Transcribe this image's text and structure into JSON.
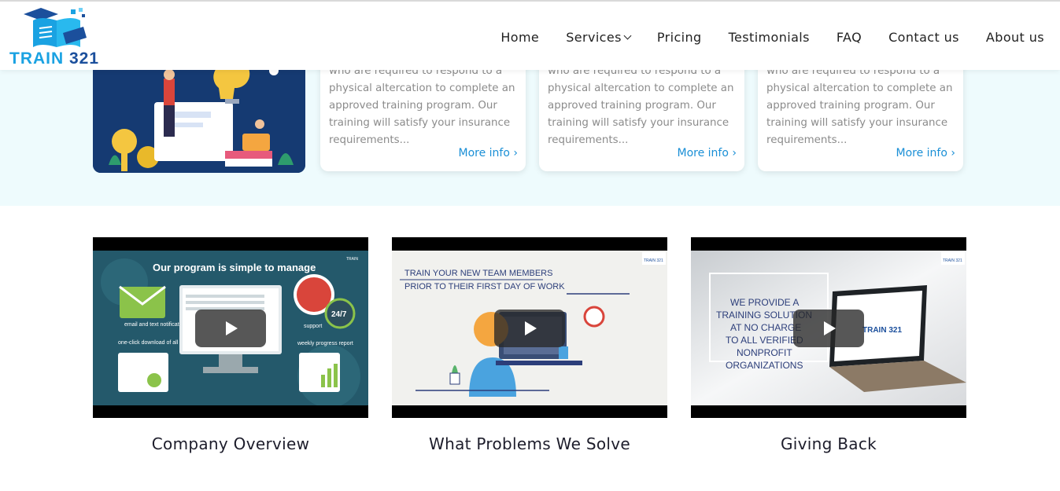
{
  "brand": {
    "logo_text_letters": "TRAIN ",
    "logo_text_number": "321",
    "colors": {
      "logo_blue": "#1aa2e2",
      "logo_navy": "#1b4f9c",
      "link_blue": "#1a8fd6",
      "band_bg": "#eefbfd"
    }
  },
  "nav": {
    "items": [
      {
        "label": "Home"
      },
      {
        "label": "Services",
        "icon": "chevron-down-icon"
      },
      {
        "label": "Pricing"
      },
      {
        "label": "Testimonials"
      },
      {
        "label": "FAQ"
      },
      {
        "label": "Contact us"
      },
      {
        "label": "About us"
      }
    ]
  },
  "cards": [
    {
      "text": "who are required to respond to a physical altercation to complete an approved training program. Our training will satisfy your insurance requirements...",
      "more_label": "More info"
    },
    {
      "text": "who are required to respond to a physical altercation to complete an approved training program. Our training will satisfy your insurance requirements...",
      "more_label": "More info"
    },
    {
      "text": "who are required to respond to a physical altercation to complete an approved training program. Our training will satisfy your insurance requirements...",
      "more_label": "More info"
    }
  ],
  "videos": [
    {
      "caption": "Company Overview",
      "thumb": {
        "headline": "Our program is simple to manage",
        "labels": [
          "email and text notifications",
          "one-click download of all certifications",
          "support",
          "24/7",
          "weekly progress report"
        ],
        "corner": "TRAIN"
      }
    },
    {
      "caption": "What Problems We Solve",
      "thumb": {
        "line1": "TRAIN YOUR NEW TEAM MEMBERS",
        "line2": "PRIOR TO THEIR FIRST DAY OF WORK",
        "corner": "TRAIN 321"
      }
    },
    {
      "caption": "Giving Back",
      "thumb": {
        "lines": [
          "WE PROVIDE A",
          "TRAINING SOLUTION",
          "AT NO CHARGE",
          "TO ALL VERIFIED",
          "NONPROFIT",
          "ORGANIZATIONS"
        ],
        "screen_logo": "TRAIN 321",
        "corner": "TRAIN 321"
      }
    }
  ]
}
